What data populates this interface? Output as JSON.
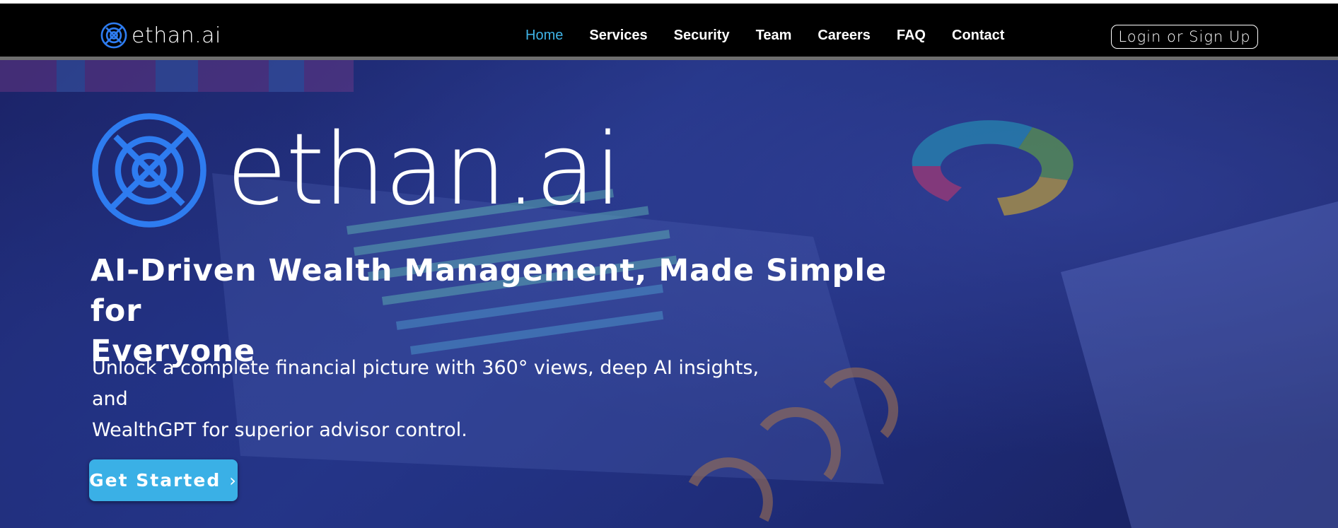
{
  "brand": {
    "name": "ethan.ai"
  },
  "nav": {
    "items": [
      {
        "label": "Home",
        "active": true
      },
      {
        "label": "Services"
      },
      {
        "label": "Security"
      },
      {
        "label": "Team"
      },
      {
        "label": "Careers"
      },
      {
        "label": "FAQ"
      },
      {
        "label": "Contact"
      }
    ],
    "login_label": "Login or Sign Up"
  },
  "hero": {
    "headline_line1": "AI-Driven Wealth Management, Made Simple for",
    "headline_line2": "Everyone",
    "subtext_line1": "Unlock a complete financial picture with 360° views, deep AI insights, and",
    "subtext_line2": "WealthGPT for superior advisor control.",
    "cta_label": "Get Started",
    "cta_icon": "chevron-right-icon"
  },
  "colors": {
    "accent": "#3ab0e6",
    "nav_active": "#3fb3e6",
    "logo_blue": "#2e7cf0",
    "topbar": "#000000",
    "hero_bg": "#273a8e"
  }
}
